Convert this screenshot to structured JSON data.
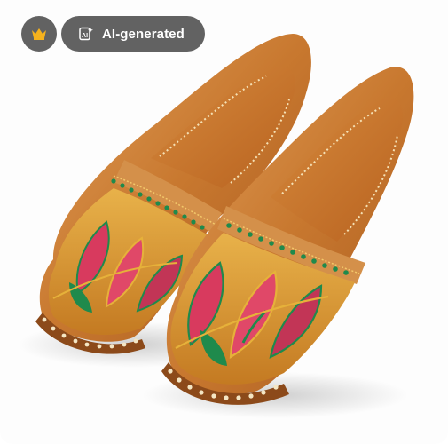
{
  "badge": {
    "icon": "crown-icon",
    "color": "#f6b21d"
  },
  "ai_tag": {
    "icon": "ai-sparkle-icon",
    "label": "AI-generated",
    "background": "#626262"
  },
  "image": {
    "subject": "pair-of-embroidered-juttis",
    "dominant_colors": [
      "#c8782f",
      "#d83a5e",
      "#1f8a4c",
      "#e6b13a"
    ]
  }
}
